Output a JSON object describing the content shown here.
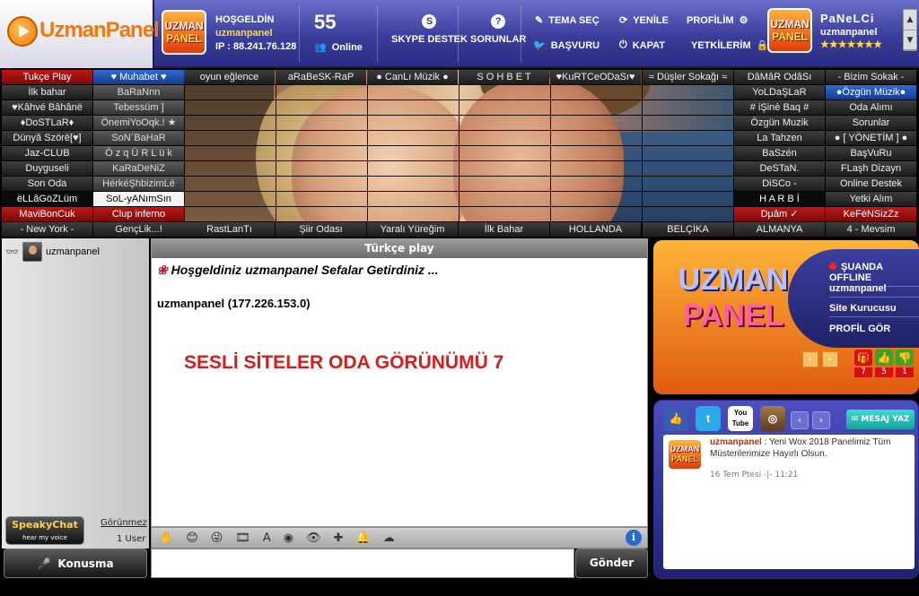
{
  "header": {
    "logo_text": "UzmanPanel",
    "badge_line1": "UZMAN",
    "badge_line2": "PANEL",
    "welcome_label": "HOŞGELDİN",
    "username": "uzmanpanel",
    "ip_text": "IP : 88.241.76.128",
    "online_count": "55",
    "online_label": "Online",
    "skype_label": "SKYPE DESTEK",
    "sorunlar_label": "SORUNLAR",
    "tema_label": "TEMA SEÇ",
    "basvuru_label": "BAŞVURU",
    "yenile_label": "YENİLE",
    "kapat_label": "KAPAT",
    "profilim_label": "PROFİLİM",
    "yetkiler_label": "YETKİLERİM",
    "rank_name": "PaNeLCi",
    "rank_user": "uzmanpanel",
    "rank_stars": "★★★★★★★"
  },
  "rooms": {
    "col1": [
      "Tukçe Play",
      "İlk bahar",
      "♥Kâhvé Bâhânë",
      "♦DoSTLaR♦",
      "Dünyâ Szörë[♥]",
      "Jaz-CLUB",
      "Duyguseli",
      "Son Oda",
      "ëLLâGöZLüm",
      "MaviBonCuk",
      "- New York -"
    ],
    "col2": [
      "♥ Muhabet ♥",
      "BaRaNnn",
      "Tebessüm ]",
      "ÖnemiYoOqk.! ★",
      "SoN´BaHaR",
      "Ö z q Ü R L ü k",
      "KaRaDeNiZ",
      "HérkéŞhbizimLé",
      "SoL-yANımSın",
      "Clup inferno",
      "GençLik...!"
    ],
    "top_mid": [
      "oyun eğlence",
      "aRaBeSK-RaP",
      "● CanLı Müzik ●",
      "S O H B E T",
      "♥KuRTCeODaSı♥",
      "≈ Düşler Sokağı ≈"
    ],
    "bottom_mid": [
      "RastLanTı",
      "Şiir Odası",
      "Yaralı Yüreğim",
      "İlk Bahar",
      "HOLLANDA",
      "BELÇİKA"
    ],
    "col9": [
      "DâMâR OdâSı",
      "YoLDaŞLaR",
      "# iŞinè Baq #",
      "Özgün Muzik",
      "La Tahzen",
      "BaSzén",
      "DeSTaN.",
      "DiSCo -",
      "H A R B İ",
      "Dµâm ✓",
      "ALMANYA"
    ],
    "col10": [
      "- Bizim Sokak -",
      "●Özgün Müzik●",
      "Oda Alımı",
      "Sorunlar",
      "● [ YÖNETİM ] ●",
      "BaşVuRu",
      "FLaşh Dizayn",
      "Online Destek",
      "Yetki Alım",
      "KeFéNSizZz",
      "4 - Mevsim"
    ]
  },
  "left_panel": {
    "user_name": "uzmanpanel",
    "speaky_title": "SpeakyChat",
    "speaky_sub": "hear my voice",
    "gorunmez": "Görünmez",
    "user_count": "1 User",
    "konusma": "Konusma"
  },
  "chat": {
    "title": "Türkçe play",
    "welcome": "Hoşgeldiniz uzmanpanel Sefalar Getirdiniz ...",
    "ip_line": "uzmanpanel (177.226.153.0)",
    "banner": "SESLİ SİTELER ODA GÖRÜNÜMÜ 7",
    "send_label": "Gönder"
  },
  "profile_panel": {
    "logo_line1": "UZMAN",
    "logo_line2": "PANEL",
    "status": "ŞUANDA OFFLINE",
    "user": "uzmanpanel",
    "role": "Site Kurucusu",
    "profile_link": "PROFİL GÖR",
    "gift_count": "7",
    "like_count": "5",
    "dislike_count": "1"
  },
  "social": {
    "mesaj_label": "MESAJ YAZ",
    "news_user": "uzmanpanel",
    "news_text": " : Yeni Wox 2018 Panelimiz Tüm Müsterilerimize Hayırlı Olsun.",
    "news_date": "16 Tem Ptesi -|- 11:21",
    "youtube_label": "You Tube"
  }
}
